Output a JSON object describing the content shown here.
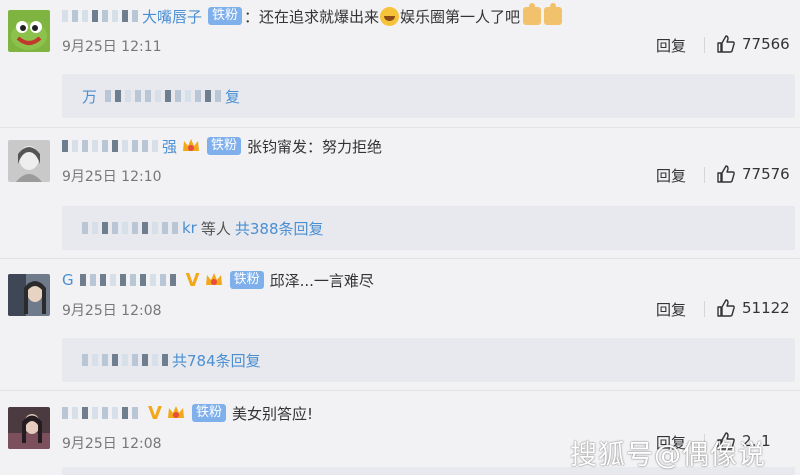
{
  "comments": [
    {
      "username": "大嘴唇子",
      "badge": "铁粉",
      "content": "：还在追求就爆出来",
      "content_suffix": "娱乐圈第一人了吧",
      "time": "9月25日 12:11",
      "reply_label": "回复",
      "likes": "77566",
      "reply_summary_text": "万",
      "reply_summary_suffix": "复"
    },
    {
      "username_suffix": "强",
      "badge": "铁粉",
      "content": "张钧甯发：努力拒绝",
      "time": "9月25日 12:10",
      "reply_label": "回复",
      "likes": "77576",
      "reply_summary_user": "kr",
      "reply_summary_mid": "等人",
      "reply_summary_count": "共388条回复"
    },
    {
      "username_prefix": "G",
      "vip_mark": "V",
      "badge": "铁粉",
      "content": "邱泽...一言难尽",
      "time": "9月25日 12:08",
      "reply_label": "回复",
      "likes": "51122",
      "reply_summary_count": "共784条回复"
    },
    {
      "vip_mark": "V",
      "badge": "铁粉",
      "content": "美女别答应!",
      "time": "9月25日 12:08",
      "reply_label": "回复",
      "likes": "2..1"
    }
  ],
  "watermark": "搜狐号@偶像说",
  "colors": {
    "username": "#eb7350",
    "link_blue": "#4a8fd2",
    "badge_bg": "#7fb0ec",
    "background": "#f2f2f4"
  },
  "icons": {
    "like": "thumbs-up-outline-icon",
    "laugh_emoji": "laughing-face-emoji",
    "thumb_emoji": "thumbs-up-emoji",
    "crown": "fan-crown-icon"
  }
}
